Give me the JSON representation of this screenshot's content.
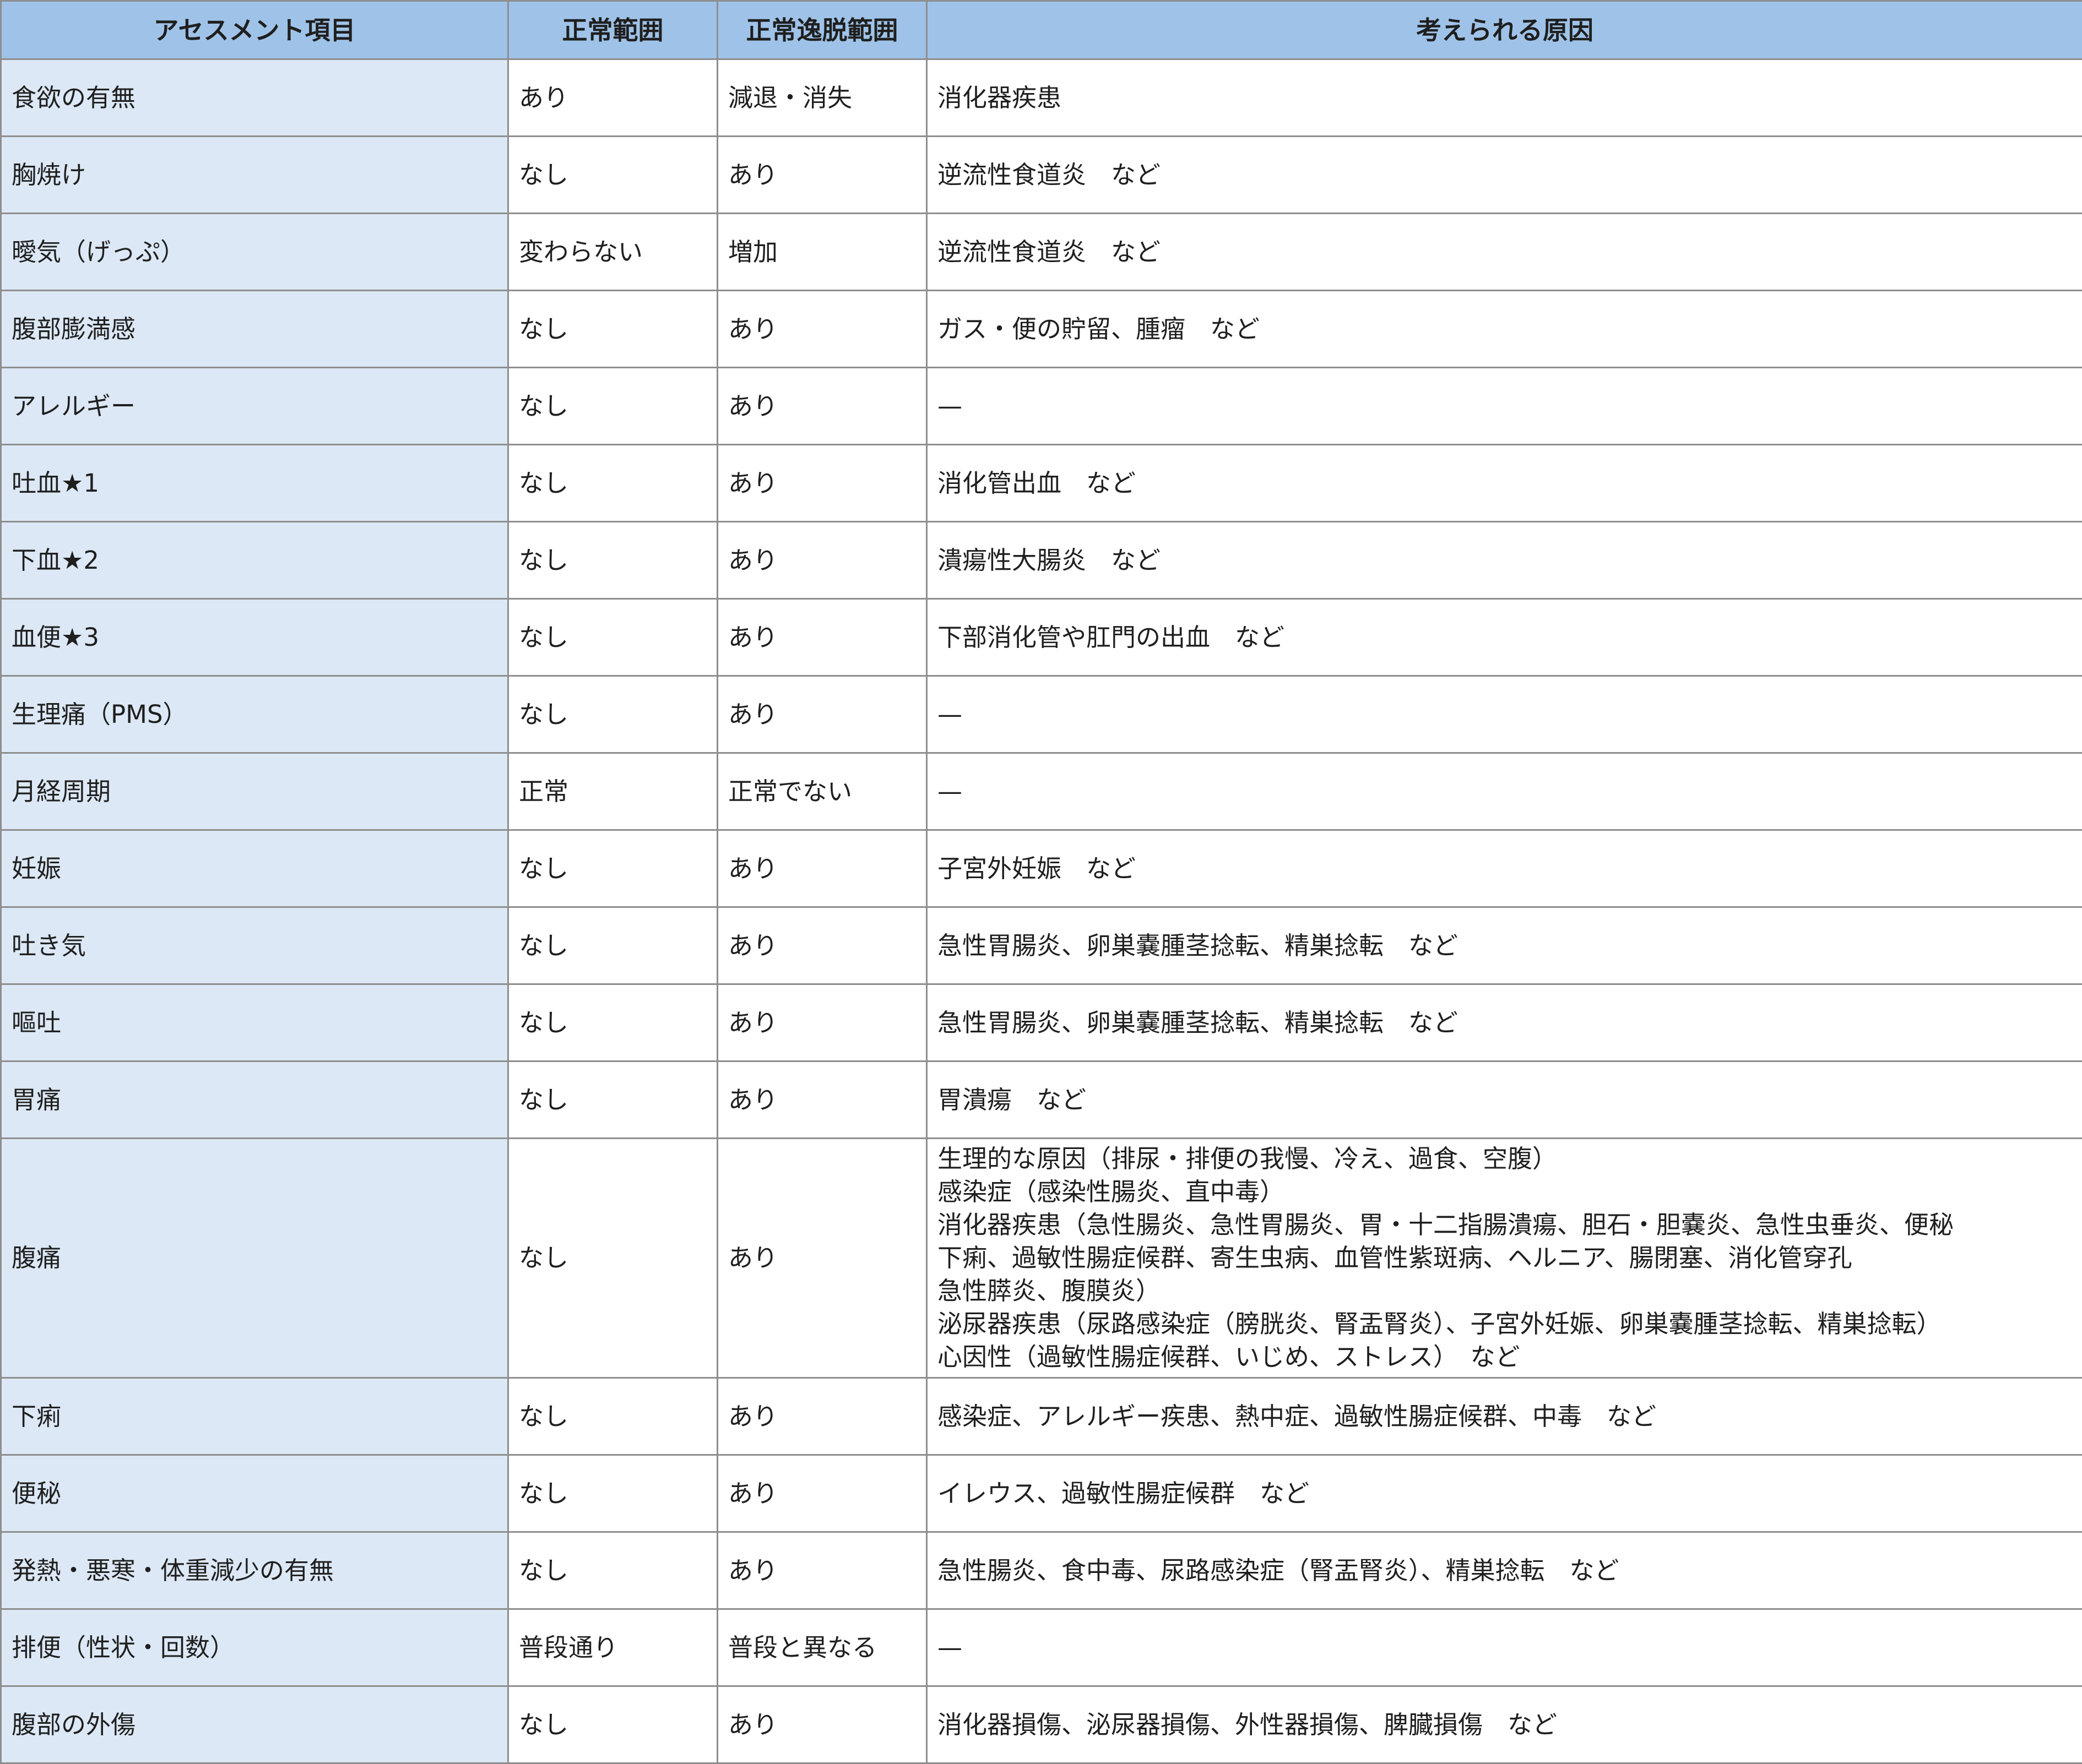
{
  "headers": {
    "item": "アセスメント項目",
    "normal": "正常範囲",
    "abnormal": "正常逸脱範囲",
    "cause": "考えられる原因"
  },
  "rows": [
    {
      "item": "食欲の有無",
      "normal": "あり",
      "abnormal": "減退・消失",
      "cause": [
        "消化器疾患"
      ]
    },
    {
      "item": "胸焼け",
      "normal": "なし",
      "abnormal": "あり",
      "cause": [
        "逆流性食道炎　など"
      ]
    },
    {
      "item": "曖気（げっぷ）",
      "normal": "変わらない",
      "abnormal": "増加",
      "cause": [
        "逆流性食道炎　など"
      ]
    },
    {
      "item": "腹部膨満感",
      "normal": "なし",
      "abnormal": "あり",
      "cause": [
        "ガス・便の貯留、腫瘤　など"
      ]
    },
    {
      "item": "アレルギー",
      "normal": "なし",
      "abnormal": "あり",
      "cause": [
        "—"
      ]
    },
    {
      "item": "吐血★1",
      "normal": "なし",
      "abnormal": "あり",
      "cause": [
        "消化管出血　など"
      ]
    },
    {
      "item": "下血★2",
      "normal": "なし",
      "abnormal": "あり",
      "cause": [
        "潰瘍性大腸炎　など"
      ]
    },
    {
      "item": "血便★3",
      "normal": "なし",
      "abnormal": "あり",
      "cause": [
        "下部消化管や肛門の出血　など"
      ]
    },
    {
      "item": "生理痛（PMS）",
      "normal": "なし",
      "abnormal": "あり",
      "cause": [
        "—"
      ]
    },
    {
      "item": "月経周期",
      "normal": "正常",
      "abnormal": "正常でない",
      "cause": [
        "—"
      ]
    },
    {
      "item": "妊娠",
      "normal": "なし",
      "abnormal": "あり",
      "cause": [
        "子宮外妊娠　など"
      ]
    },
    {
      "item": "吐き気",
      "normal": "なし",
      "abnormal": "あり",
      "cause": [
        "急性胃腸炎、卵巣嚢腫茎捻転、精巣捻転　など"
      ]
    },
    {
      "item": "嘔吐",
      "normal": "なし",
      "abnormal": "あり",
      "cause": [
        "急性胃腸炎、卵巣嚢腫茎捻転、精巣捻転　など"
      ]
    },
    {
      "item": "胃痛",
      "normal": "なし",
      "abnormal": "あり",
      "cause": [
        "胃潰瘍　など"
      ]
    },
    {
      "item": "腹痛",
      "normal": "なし",
      "abnormal": "あり",
      "cause": [
        "生理的な原因（排尿・排便の我慢、冷え、過食、空腹）",
        "感染症（感染性腸炎、直中毒）",
        "消化器疾患（急性腸炎、急性胃腸炎、胃・十二指腸潰瘍、胆石・胆嚢炎、急性虫垂炎、便秘",
        "下痢、過敏性腸症候群、寄生虫病、血管性紫斑病、ヘルニア、腸閉塞、消化管穿孔",
        "急性膵炎、腹膜炎）",
        "泌尿器疾患（尿路感染症（膀胱炎、腎盂腎炎）、子宮外妊娠、卵巣嚢腫茎捻転、精巣捻転）",
        "心因性（過敏性腸症候群、いじめ、ストレス）　など"
      ]
    },
    {
      "item": "下痢",
      "normal": "なし",
      "abnormal": "あり",
      "cause": [
        "感染症、アレルギー疾患、熱中症、過敏性腸症候群、中毒　など"
      ]
    },
    {
      "item": "便秘",
      "normal": "なし",
      "abnormal": "あり",
      "cause": [
        "イレウス、過敏性腸症候群　など"
      ]
    },
    {
      "item": "発熱・悪寒・体重減少の有無",
      "normal": "なし",
      "abnormal": "あり",
      "cause": [
        "急性腸炎、食中毒、尿路感染症（腎盂腎炎）、精巣捻転　など"
      ]
    },
    {
      "item": "排便（性状・回数）",
      "normal": "普段通り",
      "abnormal": "普段と異なる",
      "cause": [
        "—"
      ]
    },
    {
      "item": "腹部の外傷",
      "normal": "なし",
      "abnormal": "あり",
      "cause": [
        "消化器損傷、泌尿器損傷、外性器損傷、脾臓損傷　など"
      ]
    }
  ]
}
